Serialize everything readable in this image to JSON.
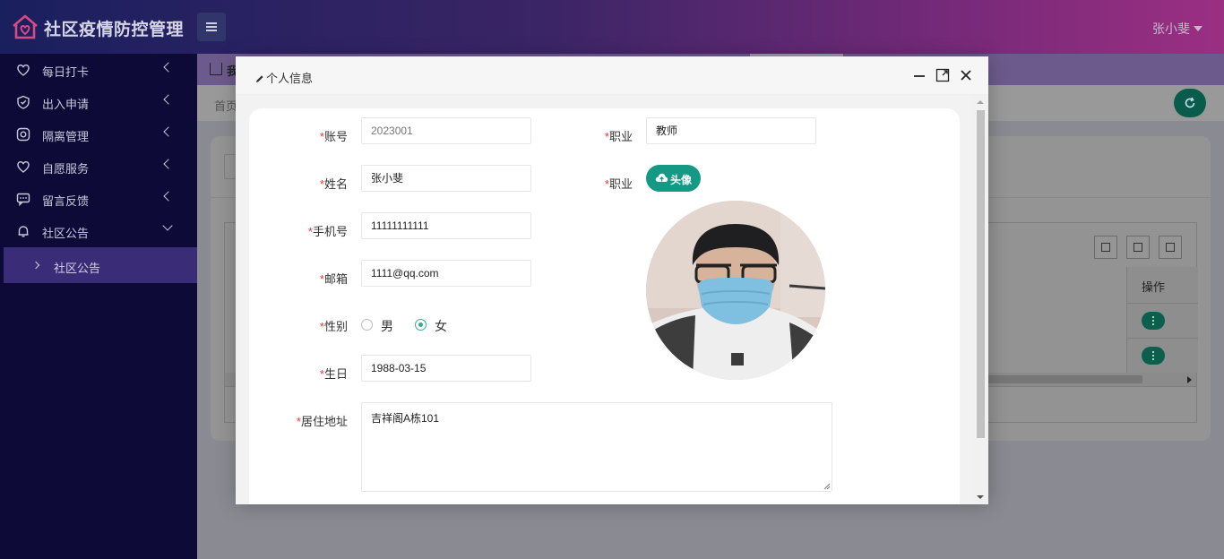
{
  "header": {
    "app_title": "社区疫情防控管理",
    "user_name": "张小斐"
  },
  "sidebar": {
    "items": [
      {
        "label": "每日打卡",
        "icon": "heart-icon"
      },
      {
        "label": "出入申请",
        "icon": "shield-icon"
      },
      {
        "label": "隔离管理",
        "icon": "target-icon"
      },
      {
        "label": "自愿服务",
        "icon": "heart-icon"
      },
      {
        "label": "留言反馈",
        "icon": "message-icon"
      },
      {
        "label": "社区公告",
        "icon": "bell-icon"
      }
    ],
    "sub_item": "社区公告"
  },
  "content": {
    "tab_label": "我",
    "breadcrumb": "首页",
    "column_operation": "操作"
  },
  "modal": {
    "title": "个人信息",
    "fields": {
      "account_label": "账号",
      "account_value": "2023001",
      "name_label": "姓名",
      "name_value": "张小斐",
      "phone_label": "手机号",
      "phone_value": "11111111111",
      "email_label": "邮箱",
      "email_value": "1111@qq.com",
      "gender_label": "性别",
      "gender_male": "男",
      "gender_female": "女",
      "gender_selected": "女",
      "birthday_label": "生日",
      "birthday_value": "1988-03-15",
      "address_label": "居住地址",
      "address_value": "吉祥阁A栋101",
      "job_label": "职业",
      "job_value": "教师",
      "avatar_label": "职业",
      "upload_label": "头像"
    }
  },
  "colors": {
    "accent_green": "#149a84",
    "required_red": "#e33333",
    "sidebar_bg": "#0e0a38"
  }
}
